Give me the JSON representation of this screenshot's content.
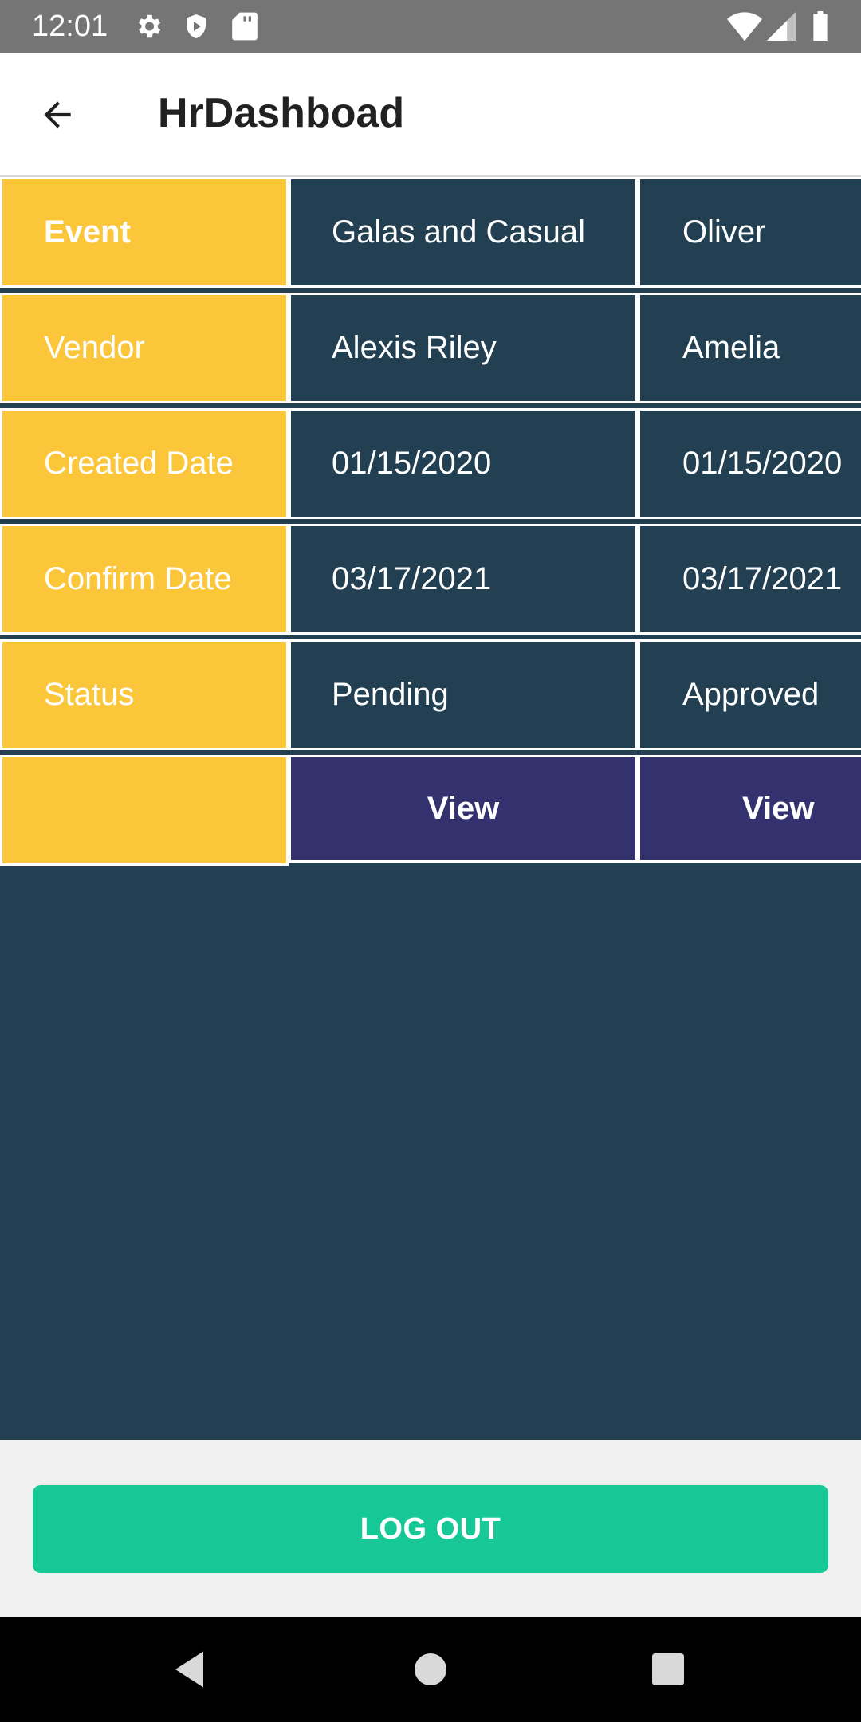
{
  "status_bar": {
    "time": "12:01",
    "icons_left": [
      "gear-icon",
      "shield-icon",
      "sd-card-icon"
    ],
    "icons_right": [
      "wifi-icon",
      "signal-icon",
      "battery-icon"
    ]
  },
  "app_bar": {
    "title": "HrDashboad",
    "back_icon": "arrow-left-icon"
  },
  "table": {
    "row_labels": [
      "Event",
      "Vendor",
      "Created Date",
      "Confirm Date",
      "Status",
      ""
    ],
    "columns": [
      {
        "event": "Galas and Casual",
        "vendor": "Alexis Riley",
        "created_date": "01/15/2020",
        "confirm_date": "03/17/2021",
        "status": "Pending",
        "action": "View"
      },
      {
        "event": "Oliver",
        "vendor": "Amelia",
        "created_date": "01/15/2020",
        "confirm_date": "03/17/2021",
        "status": "Approved",
        "action": "View"
      }
    ]
  },
  "logout_label": "LOG OUT",
  "colors": {
    "label_bg": "#fcc63b",
    "cell_bg": "#234052",
    "view_bg": "#33316e",
    "logout_bg": "#17c897"
  },
  "nav_bar": [
    "back-triangle-icon",
    "home-circle-icon",
    "recents-square-icon"
  ]
}
